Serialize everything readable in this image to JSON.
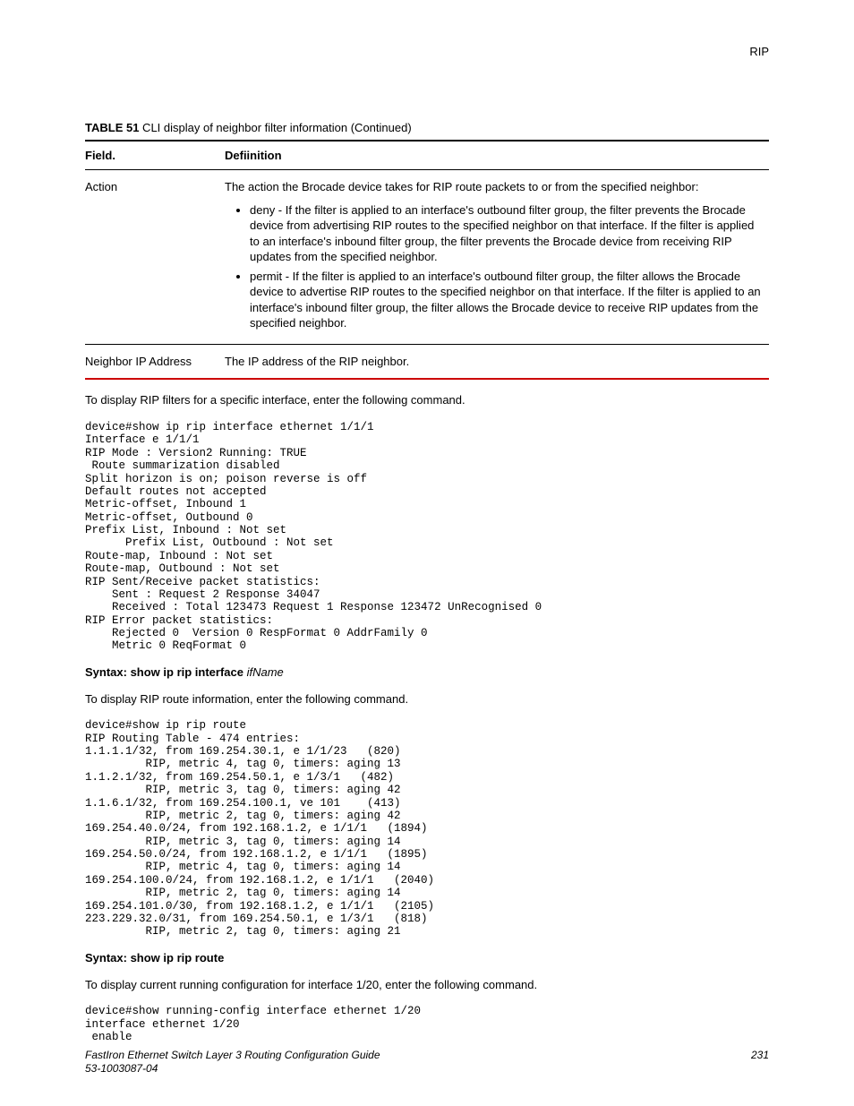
{
  "header": {
    "topRight": "RIP"
  },
  "table": {
    "captionBold": "TABLE 51",
    "captionRest": "   CLI display of neighbor filter information (Continued)",
    "col1": "Field.",
    "col2": "Defiinition",
    "row1": {
      "field": "Action",
      "intro": "The action the Brocade device takes for RIP route packets to or from the specified neighbor:",
      "bullet1": "deny - If the filter is applied to an interface's outbound filter group, the filter prevents the Brocade device from advertising RIP routes to the specified neighbor on that interface. If the filter is applied to an interface's inbound filter group, the filter prevents the Brocade device from receiving RIP updates from the specified neighbor.",
      "bullet2": "permit - If the filter is applied to an interface's outbound filter group, the filter allows the Brocade device to advertise RIP routes to the specified neighbor on that interface. If the filter is applied to an interface's inbound filter group, the filter allows the Brocade device to receive RIP updates from the specified neighbor."
    },
    "row2": {
      "field": "Neighbor IP Address",
      "def": "The IP address of the RIP neighbor."
    }
  },
  "para1": "To display RIP filters for a specific interface, enter the following command.",
  "code1": "device#show ip rip interface ethernet 1/1/1\nInterface e 1/1/1\nRIP Mode : Version2 Running: TRUE\n Route summarization disabled\nSplit horizon is on; poison reverse is off\nDefault routes not accepted\nMetric-offset, Inbound 1\nMetric-offset, Outbound 0\nPrefix List, Inbound : Not set\n      Prefix List, Outbound : Not set\nRoute-map, Inbound : Not set\nRoute-map, Outbound : Not set\nRIP Sent/Receive packet statistics:\n    Sent : Request 2 Response 34047\n    Received : Total 123473 Request 1 Response 123472 UnRecognised 0\nRIP Error packet statistics:\n    Rejected 0  Version 0 RespFormat 0 AddrFamily 0\n    Metric 0 ReqFormat 0",
  "syntax1": {
    "bold": "Syntax: show ip rip interface ",
    "ital": "ifName"
  },
  "para2": "To display RIP route information, enter the following command.",
  "code2": "device#show ip rip route \nRIP Routing Table - 474 entries:\n1.1.1.1/32, from 169.254.30.1, e 1/1/23   (820)\n         RIP, metric 4, tag 0, timers: aging 13\n1.1.2.1/32, from 169.254.50.1, e 1/3/1   (482)\n         RIP, metric 3, tag 0, timers: aging 42\n1.1.6.1/32, from 169.254.100.1, ve 101    (413)\n         RIP, metric 2, tag 0, timers: aging 42\n169.254.40.0/24, from 192.168.1.2, e 1/1/1   (1894)\n         RIP, metric 3, tag 0, timers: aging 14\n169.254.50.0/24, from 192.168.1.2, e 1/1/1   (1895)\n         RIP, metric 4, tag 0, timers: aging 14\n169.254.100.0/24, from 192.168.1.2, e 1/1/1   (2040)\n         RIP, metric 2, tag 0, timers: aging 14\n169.254.101.0/30, from 192.168.1.2, e 1/1/1   (2105)\n223.229.32.0/31, from 169.254.50.1, e 1/3/1   (818)\n         RIP, metric 2, tag 0, timers: aging 21",
  "syntax2": {
    "bold": "Syntax: show ip rip route"
  },
  "para3": "To display current running configuration for interface 1/20, enter the following command.",
  "code3": "device#show running-config interface ethernet 1/20\ninterface ethernet 1/20\n enable",
  "footer": {
    "line1": "FastIron Ethernet Switch Layer 3 Routing Configuration Guide",
    "line2": "53-1003087-04",
    "page": "231"
  }
}
